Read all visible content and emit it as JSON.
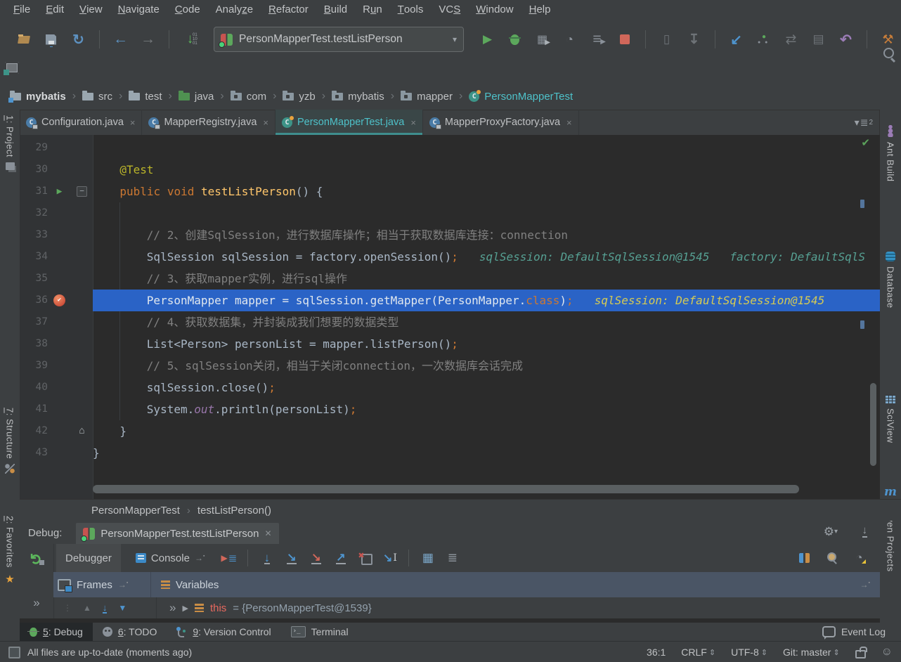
{
  "colors": {
    "accent_teal": "#4EC1C9",
    "exec_line_blue": "#2A63C6",
    "breakpoint_red": "#C75450",
    "hint_teal": "#56A093",
    "hint_yellow": "#D6CB53",
    "run_green": "#5CA85C",
    "stop_salmon": "#D1675A",
    "variable_orange": "#C88D46"
  },
  "menu": {
    "items": [
      {
        "label": "File",
        "m": 0
      },
      {
        "label": "Edit",
        "m": 0
      },
      {
        "label": "View",
        "m": 0
      },
      {
        "label": "Navigate",
        "m": 0
      },
      {
        "label": "Code",
        "m": 0
      },
      {
        "label": "Analyze",
        "m": 5
      },
      {
        "label": "Refactor",
        "m": 0
      },
      {
        "label": "Build",
        "m": 0
      },
      {
        "label": "Run",
        "m": 1
      },
      {
        "label": "Tools",
        "m": 0
      },
      {
        "label": "VCS",
        "m": 2
      },
      {
        "label": "Window",
        "m": 0
      },
      {
        "label": "Help",
        "m": 0
      }
    ]
  },
  "toolbar": {
    "run_config": {
      "label": "PersonMapperTest.testListPerson",
      "icon": "junit-run-config-icon",
      "caret": "▾"
    },
    "items": [
      {
        "name": "open-file-icon",
        "cls": "i-open"
      },
      {
        "name": "save-all-icon",
        "cls": "i-save"
      },
      {
        "name": "synchronize-icon",
        "cls": "i-sync"
      },
      {
        "sep": true
      },
      {
        "name": "back-icon",
        "cls": "i-back"
      },
      {
        "name": "forward-icon",
        "cls": "i-fwd"
      },
      {
        "sep": true
      },
      {
        "name": "update-running-application-icon",
        "cls": "i-upd"
      },
      {
        "combo": true
      },
      {
        "name": "run-icon",
        "cls": "i-run"
      },
      {
        "name": "debug-icon",
        "cls": "i-bug"
      },
      {
        "name": "run-with-coverage-icon",
        "cls": "i-cov"
      },
      {
        "name": "profiler-icon",
        "cls": "i-prof"
      },
      {
        "name": "run-dashboard-icon",
        "cls": "i-runlines"
      },
      {
        "name": "stop-icon",
        "cls": "i-stop"
      },
      {
        "sep": true
      },
      {
        "name": "attach-to-process-icon",
        "cls": "i-attach"
      },
      {
        "name": "download-icon",
        "cls": "i-dl"
      },
      {
        "sep": true
      },
      {
        "name": "update-project-icon",
        "cls": "i-vcsupd"
      },
      {
        "name": "commit-changes-icon",
        "cls": "i-commit"
      },
      {
        "name": "compare-icon",
        "cls": "i-diff"
      },
      {
        "name": "changes-icon",
        "cls": "i-patch"
      },
      {
        "name": "rollback-icon",
        "cls": "i-undo"
      },
      {
        "sep": true
      },
      {
        "name": "settings-icon",
        "cls": "i-wrench"
      },
      {
        "name": "project-structure-icon",
        "cls": "i-struct"
      }
    ]
  },
  "breadcrumbs": {
    "items": [
      {
        "label": "mybatis",
        "icon": "project",
        "bold": true
      },
      {
        "label": "src",
        "icon": "folder"
      },
      {
        "label": "test",
        "icon": "folder"
      },
      {
        "label": "java",
        "icon": "folder-green"
      },
      {
        "label": "com",
        "icon": "package"
      },
      {
        "label": "yzb",
        "icon": "package"
      },
      {
        "label": "mybatis",
        "icon": "package"
      },
      {
        "label": "mapper",
        "icon": "package"
      },
      {
        "label": "PersonMapperTest",
        "icon": "class-run",
        "accent": true
      }
    ]
  },
  "editor": {
    "tabs": [
      {
        "label": "Configuration.java",
        "icon": "class-lock"
      },
      {
        "label": "MapperRegistry.java",
        "icon": "class-lock"
      },
      {
        "label": "PersonMapperTest.java",
        "icon": "class-run",
        "active": true
      },
      {
        "label": "MapperProxyFactory.java",
        "icon": "class-lock"
      }
    ],
    "tab_overflow_count": "2",
    "breadcrumb": {
      "class_name": "PersonMapperTest",
      "method": "testListPerson()"
    },
    "lines": [
      {
        "num": 29,
        "indent": 0,
        "tokens": []
      },
      {
        "num": 30,
        "indent": 4,
        "tokens": [
          {
            "t": "@Test",
            "c": "ann"
          }
        ]
      },
      {
        "num": 31,
        "indent": 4,
        "gutter": "run",
        "fold": "open",
        "tokens": [
          {
            "t": "public ",
            "c": "kw"
          },
          {
            "t": "void ",
            "c": "kw"
          },
          {
            "t": "testListPerson",
            "c": "decl"
          },
          {
            "t": "() {",
            "c": "def"
          }
        ]
      },
      {
        "num": 32,
        "indent": 8,
        "guide": true,
        "tokens": []
      },
      {
        "num": 33,
        "indent": 8,
        "guide": true,
        "tokens": [
          {
            "t": "// 2、创建SqlSession，进行数据库操作；相当于获取数据库连接：connection",
            "c": "cmt"
          }
        ]
      },
      {
        "num": 34,
        "indent": 8,
        "guide": true,
        "tokens": [
          {
            "t": "SqlSession sqlSession = factory.openSession()",
            "c": "def"
          },
          {
            "t": ";",
            "c": "semi"
          }
        ],
        "hint": {
          "text": "sqlSession: DefaultSqlSession@1545   factory: DefaultSqlS",
          "c": "teal"
        }
      },
      {
        "num": 35,
        "indent": 8,
        "guide": true,
        "tokens": [
          {
            "t": "// 3、获取mapper实例，进行sql操作",
            "c": "cmt"
          }
        ]
      },
      {
        "num": 36,
        "indent": 8,
        "exec": true,
        "gutter": "bp",
        "tokens": [
          {
            "t": "PersonMapper mapper = sqlSession.getMapper(PersonMapper.",
            "c": "def"
          },
          {
            "t": "class",
            "c": "kw"
          },
          {
            "t": ")",
            "c": "def"
          },
          {
            "t": ";",
            "c": "semi"
          }
        ],
        "hint": {
          "text": "sqlSession: DefaultSqlSession@1545",
          "c": "yellow"
        }
      },
      {
        "num": 37,
        "indent": 8,
        "guide": true,
        "tokens": [
          {
            "t": "// 4、获取数据集，并封装成我们想要的数据类型",
            "c": "cmt"
          }
        ]
      },
      {
        "num": 38,
        "indent": 8,
        "guide": true,
        "tokens": [
          {
            "t": "List<Person> personList = mapper.listPerson()",
            "c": "def"
          },
          {
            "t": ";",
            "c": "semi"
          }
        ]
      },
      {
        "num": 39,
        "indent": 8,
        "guide": true,
        "tokens": [
          {
            "t": "// 5、sqlSession关闭，相当于关闭connection，一次数据库会话完成",
            "c": "cmt"
          }
        ]
      },
      {
        "num": 40,
        "indent": 8,
        "guide": true,
        "tokens": [
          {
            "t": "sqlSession.close()",
            "c": "def"
          },
          {
            "t": ";",
            "c": "semi"
          }
        ]
      },
      {
        "num": 41,
        "indent": 8,
        "guide": true,
        "tokens": [
          {
            "t": "System.",
            "c": "def"
          },
          {
            "t": "out",
            "c": "field"
          },
          {
            "t": ".println(personList)",
            "c": "def"
          },
          {
            "t": ";",
            "c": "semi"
          }
        ]
      },
      {
        "num": 42,
        "indent": 4,
        "fold": "close",
        "tokens": [
          {
            "t": "}",
            "c": "def"
          }
        ]
      },
      {
        "num": 43,
        "indent": 0,
        "tokens": [
          {
            "t": "}",
            "c": "def"
          }
        ]
      }
    ]
  },
  "strips": {
    "left": [
      {
        "label": "1: Project",
        "m": 0,
        "icon": "project-tool-icon",
        "cls": "proj-ic",
        "pos": "p-project"
      },
      {
        "label": "7: Structure",
        "m": 0,
        "icon": "structure-tool-icon",
        "cls": "struct-ic",
        "pos": "p-structure"
      },
      {
        "label": "2: Favorites",
        "m": 0,
        "icon": "favorites-star-icon",
        "cls": "fav-ic",
        "pos": "p-favorites"
      }
    ],
    "right": [
      {
        "label": "Ant Build",
        "icon": "ant-build-icon",
        "cls": "ant-ic",
        "pos": "r-ant"
      },
      {
        "label": "Database",
        "icon": "database-icon",
        "cls": "db-ic",
        "pos": "r-db"
      },
      {
        "label": "SciView",
        "icon": "sciview-icon",
        "cls": "sci-ic",
        "pos": "r-sci"
      },
      {
        "label": "Maven Projects",
        "icon": "maven-icon",
        "cls": "mvn-ic",
        "pos": "r-maven"
      }
    ]
  },
  "debug": {
    "label": "Debug:",
    "session": {
      "label": "PersonMapperTest.testListPerson"
    },
    "tabs": [
      {
        "label": "Debugger",
        "active": true
      },
      {
        "label": "Console",
        "icon": "console-icon"
      }
    ],
    "toolbar_icons": [
      {
        "name": "show-execution-point-icon",
        "cls": "s-exec"
      },
      {
        "sep": true
      },
      {
        "name": "step-over-icon",
        "cls": "s-over"
      },
      {
        "name": "step-into-icon",
        "cls": "s-into"
      },
      {
        "name": "force-step-into-icon",
        "cls": "s-force"
      },
      {
        "name": "step-out-icon",
        "cls": "s-out"
      },
      {
        "name": "drop-frame-icon",
        "cls": "s-drop"
      },
      {
        "name": "run-to-cursor-icon",
        "cls": "s-cursor"
      },
      {
        "sep": true
      },
      {
        "name": "evaluate-expression-icon",
        "cls": "s-eval"
      },
      {
        "name": "settings-layout-icon",
        "cls": "s-layout"
      }
    ],
    "right_icons": [
      {
        "name": "threads-icon",
        "cls": "s-threads"
      },
      {
        "name": "memory-view-icon",
        "cls": "s-memory"
      },
      {
        "name": "overhead-monitor-icon",
        "cls": "s-gauge"
      }
    ],
    "frames": {
      "label": "Frames"
    },
    "variables": {
      "label": "Variables"
    },
    "variable_row": {
      "name": "this",
      "value": "= {PersonMapperTest@1539}"
    }
  },
  "bottom_bar": {
    "buttons": [
      {
        "label": "5: Debug",
        "m": 0,
        "icon": "debug-bug-icon",
        "cls": "b-bug",
        "active": true
      },
      {
        "label": "6: TODO",
        "m": 0,
        "icon": "todo-icon",
        "cls": "b-todo"
      },
      {
        "label": "9: Version Control",
        "m": 0,
        "icon": "version-control-icon",
        "cls": "b-branch"
      },
      {
        "label": "Terminal",
        "m": -1,
        "icon": "terminal-icon",
        "cls": "b-term"
      }
    ],
    "event_log": "Event Log"
  },
  "status": {
    "message": "All files are up-to-date (moments ago)",
    "items": [
      {
        "label": "36:1",
        "name": "caret-position",
        "updown": false
      },
      {
        "label": "CRLF",
        "name": "line-separator",
        "updown": true
      },
      {
        "label": "UTF-8",
        "name": "file-encoding",
        "updown": true
      },
      {
        "label": "Git: master",
        "name": "git-branch",
        "updown": true
      }
    ]
  }
}
